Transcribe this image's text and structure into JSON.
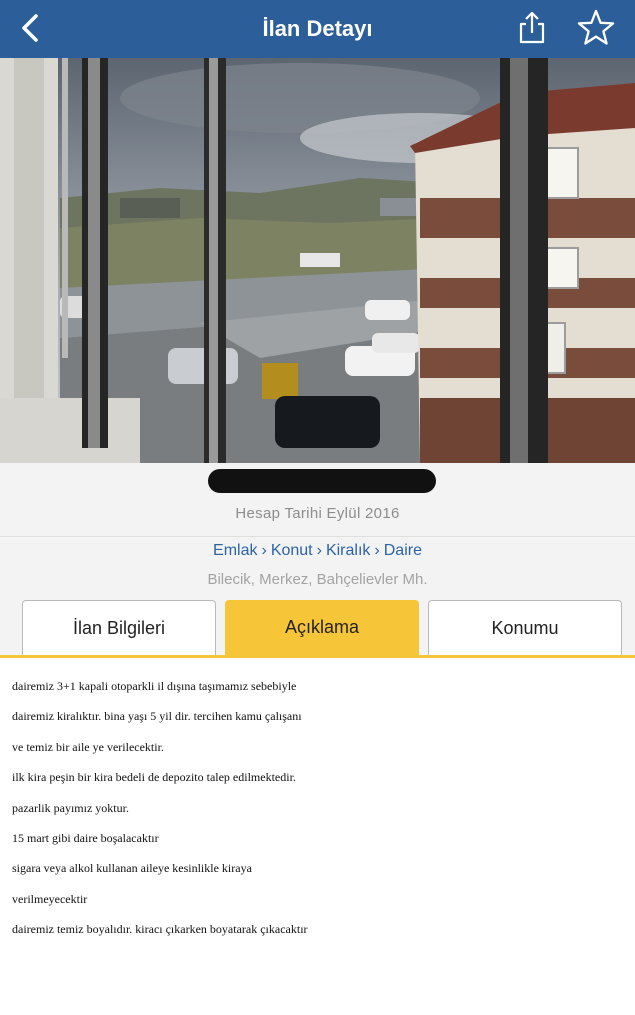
{
  "navbar": {
    "title": "İlan Detayı",
    "back_icon": "chevron-left-icon",
    "share_icon": "share-icon",
    "favorite_icon": "star-outline-icon",
    "color": "#2c5e9a"
  },
  "listing": {
    "account_date": "Hesap Tarihi  Eylül 2016",
    "breadcrumb": [
      "Emlak",
      "Konut",
      "Kiralık",
      "Daire"
    ],
    "breadcrumb_separator": "›",
    "location": "Bilecik, Merkez, Bahçelievler Mh."
  },
  "tabs": [
    {
      "label": "İlan Bilgileri",
      "active": false
    },
    {
      "label": "Açıklama",
      "active": true
    },
    {
      "label": "Konumu",
      "active": false
    }
  ],
  "accent_color": "#f7c538",
  "description": [
    "dairemiz 3+1 kapali otoparkli il dışına taşımamız sebebiyle",
    "dairemiz kiralıktır. bina yaşı 5 yil dir. tercihen kamu çalışanı",
    "ve temiz bir aile ye verilecektir.",
    "ilk kira peşin bir kira bedeli de depozito talep edilmektedir.",
    "pazarlik payımız yoktur.",
    "15 mart gibi daire boşalacaktır",
    "sigara veya alkol kullanan aileye kesinlikle kiraya",
    "verilmeyecektir",
    "dairemiz temiz boyalıdır. kiracı çıkarken boyatarak çıkacaktır"
  ]
}
